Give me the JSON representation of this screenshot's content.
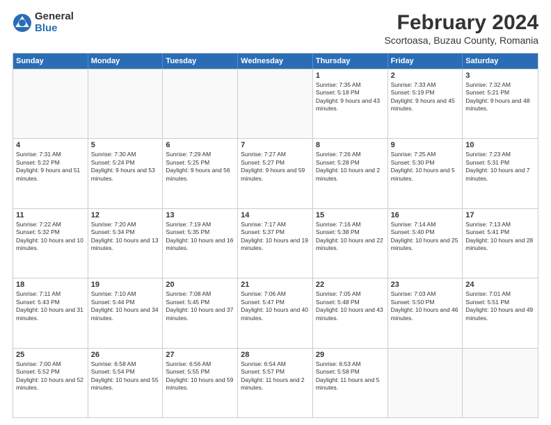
{
  "header": {
    "logo": {
      "general": "General",
      "blue": "Blue"
    },
    "month": "February 2024",
    "location": "Scortoasa, Buzau County, Romania"
  },
  "days_of_week": [
    "Sunday",
    "Monday",
    "Tuesday",
    "Wednesday",
    "Thursday",
    "Friday",
    "Saturday"
  ],
  "weeks": [
    [
      {
        "day": "",
        "info": ""
      },
      {
        "day": "",
        "info": ""
      },
      {
        "day": "",
        "info": ""
      },
      {
        "day": "",
        "info": ""
      },
      {
        "day": "1",
        "info": "Sunrise: 7:35 AM\nSunset: 5:18 PM\nDaylight: 9 hours and 43 minutes."
      },
      {
        "day": "2",
        "info": "Sunrise: 7:33 AM\nSunset: 5:19 PM\nDaylight: 9 hours and 45 minutes."
      },
      {
        "day": "3",
        "info": "Sunrise: 7:32 AM\nSunset: 5:21 PM\nDaylight: 9 hours and 48 minutes."
      }
    ],
    [
      {
        "day": "4",
        "info": "Sunrise: 7:31 AM\nSunset: 5:22 PM\nDaylight: 9 hours and 51 minutes."
      },
      {
        "day": "5",
        "info": "Sunrise: 7:30 AM\nSunset: 5:24 PM\nDaylight: 9 hours and 53 minutes."
      },
      {
        "day": "6",
        "info": "Sunrise: 7:29 AM\nSunset: 5:25 PM\nDaylight: 9 hours and 56 minutes."
      },
      {
        "day": "7",
        "info": "Sunrise: 7:27 AM\nSunset: 5:27 PM\nDaylight: 9 hours and 59 minutes."
      },
      {
        "day": "8",
        "info": "Sunrise: 7:26 AM\nSunset: 5:28 PM\nDaylight: 10 hours and 2 minutes."
      },
      {
        "day": "9",
        "info": "Sunrise: 7:25 AM\nSunset: 5:30 PM\nDaylight: 10 hours and 5 minutes."
      },
      {
        "day": "10",
        "info": "Sunrise: 7:23 AM\nSunset: 5:31 PM\nDaylight: 10 hours and 7 minutes."
      }
    ],
    [
      {
        "day": "11",
        "info": "Sunrise: 7:22 AM\nSunset: 5:32 PM\nDaylight: 10 hours and 10 minutes."
      },
      {
        "day": "12",
        "info": "Sunrise: 7:20 AM\nSunset: 5:34 PM\nDaylight: 10 hours and 13 minutes."
      },
      {
        "day": "13",
        "info": "Sunrise: 7:19 AM\nSunset: 5:35 PM\nDaylight: 10 hours and 16 minutes."
      },
      {
        "day": "14",
        "info": "Sunrise: 7:17 AM\nSunset: 5:37 PM\nDaylight: 10 hours and 19 minutes."
      },
      {
        "day": "15",
        "info": "Sunrise: 7:16 AM\nSunset: 5:38 PM\nDaylight: 10 hours and 22 minutes."
      },
      {
        "day": "16",
        "info": "Sunrise: 7:14 AM\nSunset: 5:40 PM\nDaylight: 10 hours and 25 minutes."
      },
      {
        "day": "17",
        "info": "Sunrise: 7:13 AM\nSunset: 5:41 PM\nDaylight: 10 hours and 28 minutes."
      }
    ],
    [
      {
        "day": "18",
        "info": "Sunrise: 7:11 AM\nSunset: 5:43 PM\nDaylight: 10 hours and 31 minutes."
      },
      {
        "day": "19",
        "info": "Sunrise: 7:10 AM\nSunset: 5:44 PM\nDaylight: 10 hours and 34 minutes."
      },
      {
        "day": "20",
        "info": "Sunrise: 7:08 AM\nSunset: 5:45 PM\nDaylight: 10 hours and 37 minutes."
      },
      {
        "day": "21",
        "info": "Sunrise: 7:06 AM\nSunset: 5:47 PM\nDaylight: 10 hours and 40 minutes."
      },
      {
        "day": "22",
        "info": "Sunrise: 7:05 AM\nSunset: 5:48 PM\nDaylight: 10 hours and 43 minutes."
      },
      {
        "day": "23",
        "info": "Sunrise: 7:03 AM\nSunset: 5:50 PM\nDaylight: 10 hours and 46 minutes."
      },
      {
        "day": "24",
        "info": "Sunrise: 7:01 AM\nSunset: 5:51 PM\nDaylight: 10 hours and 49 minutes."
      }
    ],
    [
      {
        "day": "25",
        "info": "Sunrise: 7:00 AM\nSunset: 5:52 PM\nDaylight: 10 hours and 52 minutes."
      },
      {
        "day": "26",
        "info": "Sunrise: 6:58 AM\nSunset: 5:54 PM\nDaylight: 10 hours and 55 minutes."
      },
      {
        "day": "27",
        "info": "Sunrise: 6:56 AM\nSunset: 5:55 PM\nDaylight: 10 hours and 59 minutes."
      },
      {
        "day": "28",
        "info": "Sunrise: 6:54 AM\nSunset: 5:57 PM\nDaylight: 11 hours and 2 minutes."
      },
      {
        "day": "29",
        "info": "Sunrise: 6:53 AM\nSunset: 5:58 PM\nDaylight: 11 hours and 5 minutes."
      },
      {
        "day": "",
        "info": ""
      },
      {
        "day": "",
        "info": ""
      }
    ]
  ]
}
